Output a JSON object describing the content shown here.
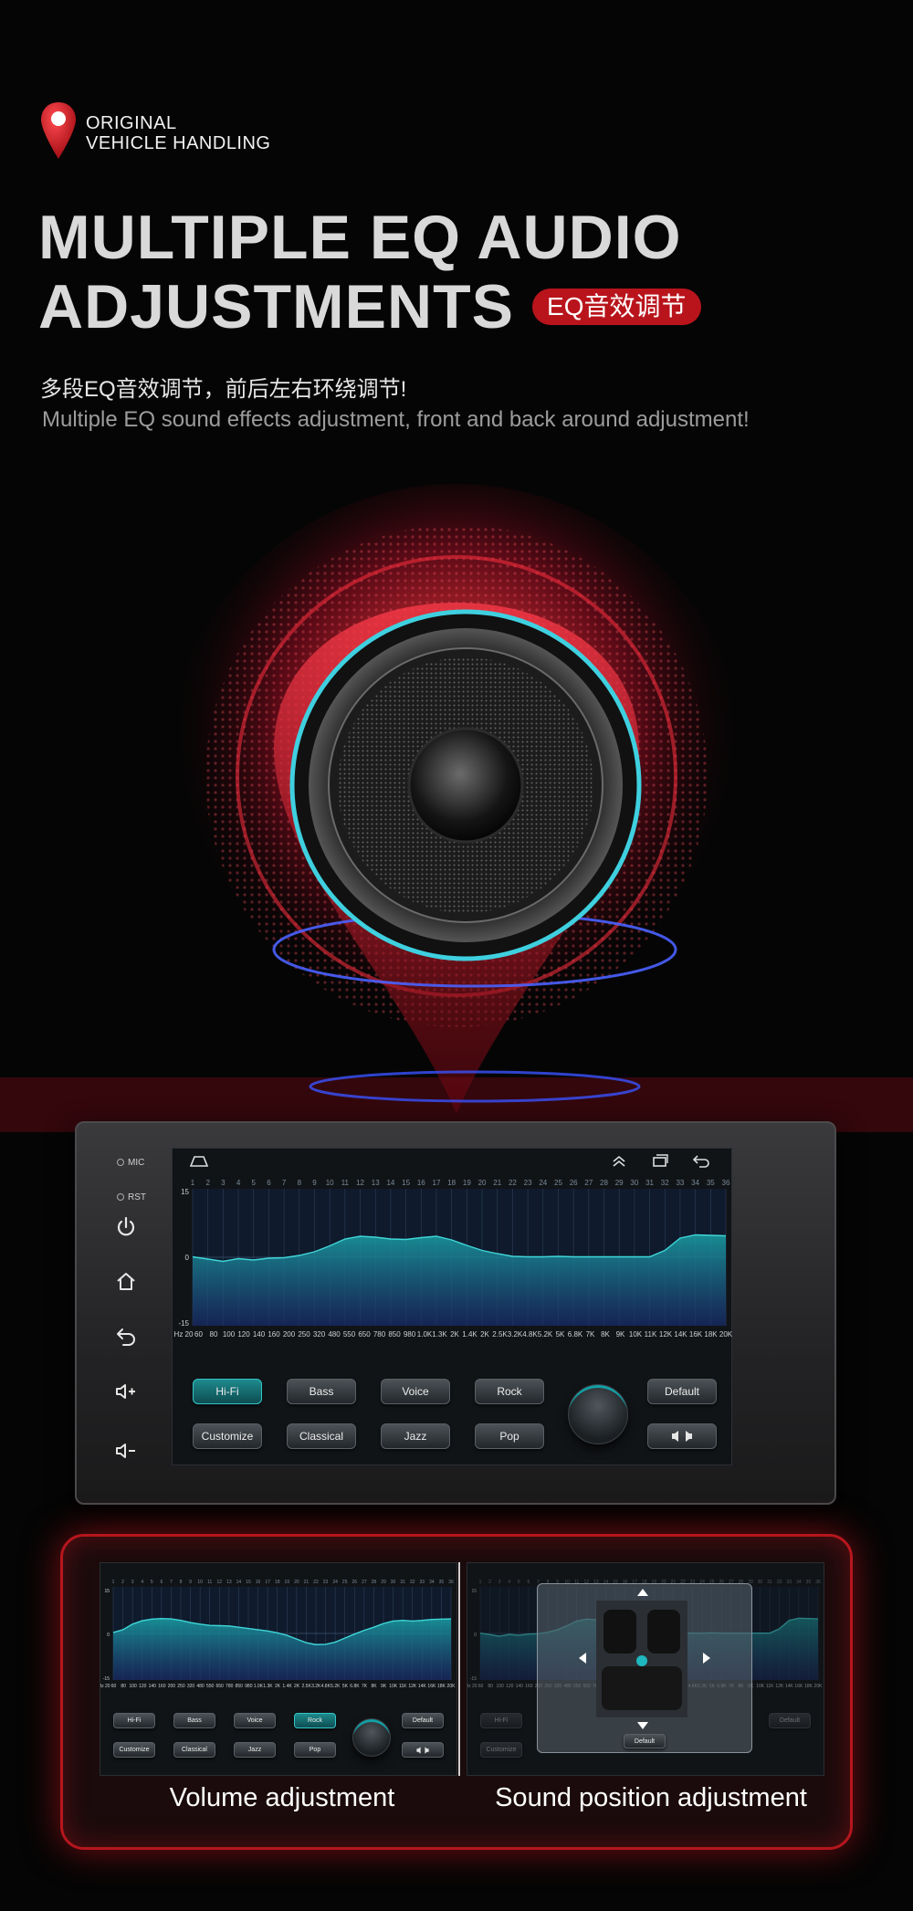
{
  "brand": {
    "line1": "ORIGINAL",
    "line2": "VEHICLE HANDLING"
  },
  "title": {
    "line1": "MULTIPLE EQ AUDIO",
    "line2": "ADJUSTMENTS",
    "badge": "EQ音效调节"
  },
  "subtitle_cn": "多段EQ音效调节，前后左右环绕调节!",
  "subtitle_en": "Multiple EQ sound effects adjustment, front and back around adjustment!",
  "unit": {
    "side_labels": [
      "MIC",
      "RST"
    ],
    "side_icons": [
      "power-icon",
      "home-icon",
      "back-icon",
      "volume-up-icon",
      "volume-down-icon"
    ]
  },
  "eq": {
    "band_numbers": [
      "1",
      "2",
      "3",
      "4",
      "5",
      "6",
      "7",
      "8",
      "9",
      "10",
      "11",
      "12",
      "13",
      "14",
      "15",
      "16",
      "17",
      "18",
      "19",
      "20",
      "21",
      "22",
      "23",
      "24",
      "25",
      "26",
      "27",
      "28",
      "29",
      "30",
      "31",
      "32",
      "33",
      "34",
      "35",
      "36"
    ],
    "y_top": "15",
    "y_mid": "0",
    "y_bottom": "-15",
    "freq_labels": [
      "Hz 20",
      "60",
      "80",
      "100",
      "120",
      "140",
      "160",
      "200",
      "250",
      "320",
      "480",
      "550",
      "650",
      "780",
      "850",
      "980",
      "1.0K",
      "1.3K",
      "2K",
      "1.4K",
      "2K",
      "2.5K",
      "3.2K",
      "4.8K",
      "5.2K",
      "5K",
      "6.8K",
      "7K",
      "8K",
      "9K",
      "10K",
      "11K",
      "12K",
      "14K",
      "16K",
      "18K",
      "20K"
    ],
    "levels": [
      0.1,
      -0.4,
      -0.9,
      -0.3,
      -0.6,
      -0.2,
      -0.1,
      0.4,
      1.2,
      2.5,
      4.0,
      4.6,
      4.4,
      4.0,
      3.9,
      4.3,
      4.6,
      3.8,
      2.6,
      1.5,
      0.8,
      0.2,
      0.1,
      0.1,
      0.2,
      0.1,
      0.1,
      0.1,
      0.1,
      0.1,
      0.1,
      1.5,
      4.2,
      4.9,
      4.8,
      4.7
    ],
    "levels_volume": [
      0.3,
      1.2,
      3.0,
      4.1,
      4.6,
      4.8,
      4.7,
      4.2,
      3.5,
      3.0,
      2.6,
      2.5,
      2.4,
      2.0,
      1.6,
      1.2,
      0.8,
      0.2,
      -0.6,
      -1.8,
      -3.0,
      -3.6,
      -3.5,
      -2.8,
      -1.5,
      -0.2,
      1.0,
      2.0,
      3.2,
      4.0,
      4.2,
      4.0,
      4.2,
      4.5,
      4.6,
      4.7
    ]
  },
  "buttons": {
    "row1": [
      "Hi-Fi",
      "Bass",
      "Voice",
      "Rock"
    ],
    "row2": [
      "Customize",
      "Classical",
      "Jazz",
      "Pop"
    ],
    "default": "Default",
    "balance_icon": "speaker-balance-icon"
  },
  "panel": {
    "left_caption": "Volume adjustment",
    "right_caption": "Sound position adjustment",
    "popup_default": "Default"
  },
  "colors": {
    "accent_red": "#b9141c",
    "teal": "#1e8a8c",
    "title_gray": "#d9d9d9"
  }
}
